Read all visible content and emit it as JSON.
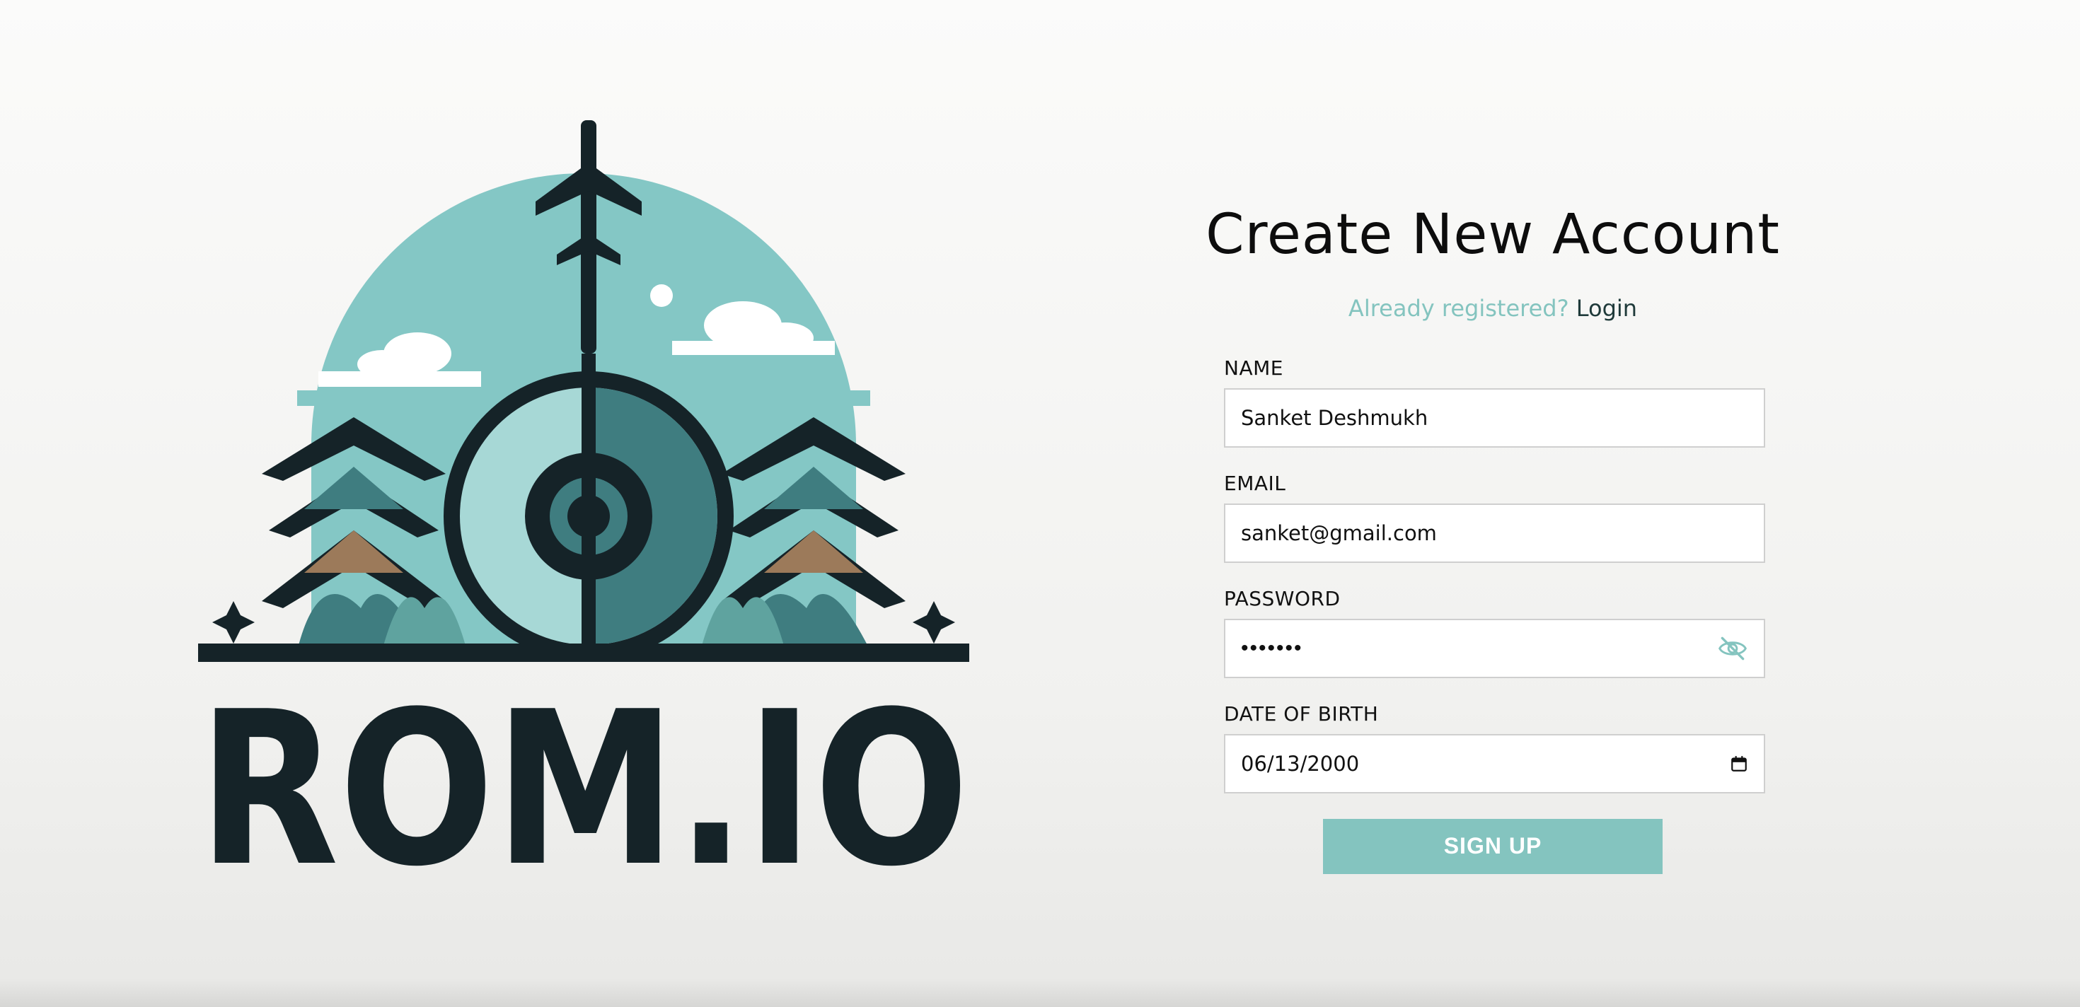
{
  "logo": {
    "icon": "rom-io-logo",
    "wordmark": "ROM.IO",
    "colors": {
      "dark": "#152328",
      "teal": "#84c7c5",
      "teal_dark": "#3f7d80",
      "brown": "#9c7a5a"
    }
  },
  "form": {
    "title": "Create New Account",
    "login_prompt": "Already registered?",
    "login_link": "Login",
    "fields": {
      "name": {
        "label": "NAME",
        "value": "Sanket Deshmukh"
      },
      "email": {
        "label": "EMAIL",
        "value": "sanket@gmail.com"
      },
      "password": {
        "label": "PASSWORD",
        "masked_value": "•••••••",
        "toggle_icon": "eye-off-icon"
      },
      "dob": {
        "label": "DATE OF BIRTH",
        "value": "06/13/2000",
        "picker_icon": "calendar-icon"
      }
    },
    "submit_label": "SIGN UP"
  },
  "theme": {
    "accent": "#84c4bf",
    "text": "#111111",
    "input_border": "#cfcfcf"
  }
}
